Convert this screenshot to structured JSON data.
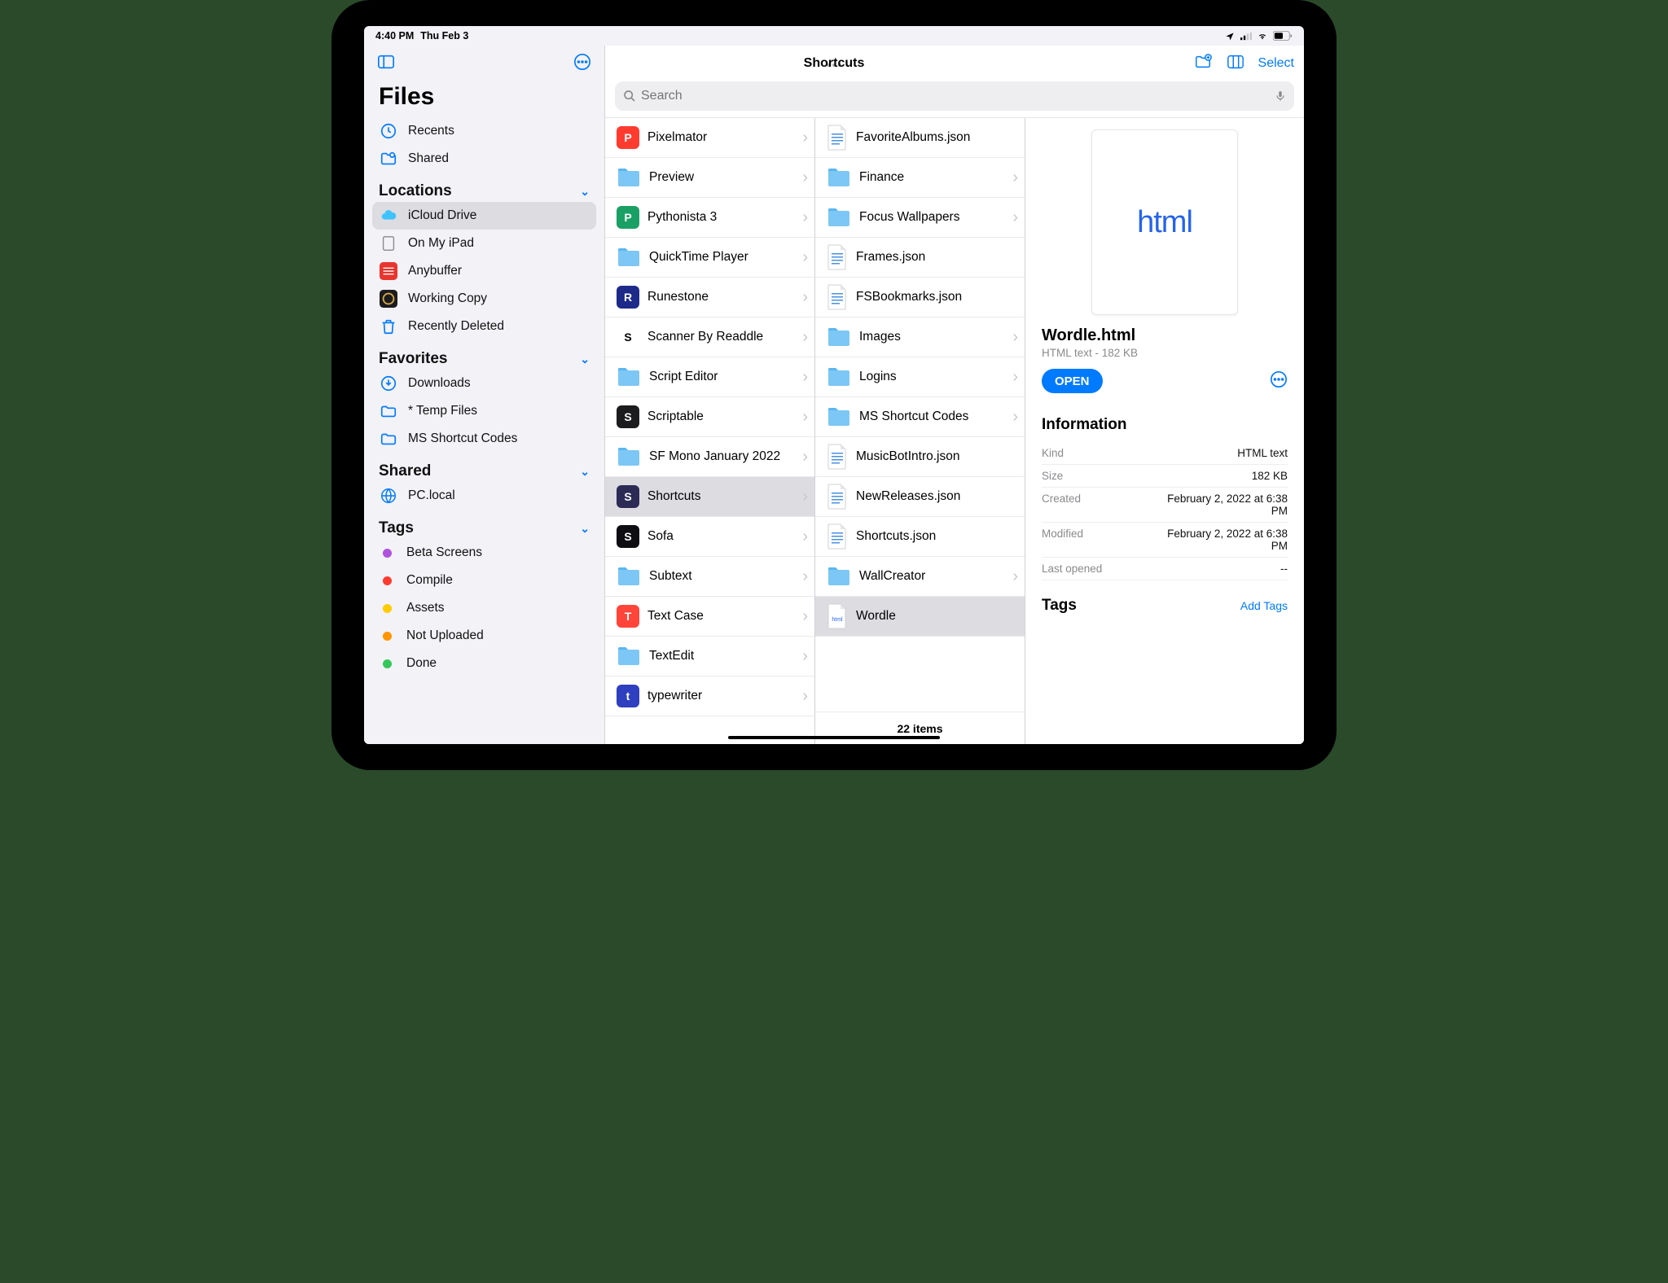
{
  "status": {
    "time": "4:40 PM",
    "date": "Thu Feb 3"
  },
  "sidebar": {
    "title": "Files",
    "recents": "Recents",
    "shared": "Shared",
    "sections": {
      "locations": {
        "header": "Locations",
        "items": [
          {
            "label": "iCloud Drive",
            "selected": true
          },
          {
            "label": "On My iPad"
          },
          {
            "label": "Anybuffer"
          },
          {
            "label": "Working Copy"
          },
          {
            "label": "Recently Deleted"
          }
        ]
      },
      "favorites": {
        "header": "Favorites",
        "items": [
          {
            "label": "Downloads"
          },
          {
            "label": "* Temp Files"
          },
          {
            "label": "MS Shortcut Codes"
          }
        ]
      },
      "shared": {
        "header": "Shared",
        "items": [
          {
            "label": "PC.local"
          }
        ]
      },
      "tags": {
        "header": "Tags",
        "items": [
          {
            "label": "Beta Screens",
            "color": "#af52de"
          },
          {
            "label": "Compile",
            "color": "#ff3b30"
          },
          {
            "label": "Assets",
            "color": "#ffcc00"
          },
          {
            "label": "Not Uploaded",
            "color": "#ff9500"
          },
          {
            "label": "Done",
            "color": "#34c759"
          }
        ]
      }
    }
  },
  "nav": {
    "title": "Shortcuts",
    "select": "Select"
  },
  "search": {
    "placeholder": "Search"
  },
  "col1": [
    {
      "label": "Pixelmator",
      "type": "app",
      "bg": "#ff3b30"
    },
    {
      "label": "Preview",
      "type": "folder"
    },
    {
      "label": "Pythonista 3",
      "type": "app",
      "bg": "#1aa064"
    },
    {
      "label": "QuickTime Player",
      "type": "folder"
    },
    {
      "label": "Runestone",
      "type": "app",
      "bg": "#1d2a8a"
    },
    {
      "label": "Scanner By Readdle",
      "type": "app",
      "bg": "#ffffff",
      "fg": "#000"
    },
    {
      "label": "Script Editor",
      "type": "folder"
    },
    {
      "label": "Scriptable",
      "type": "app",
      "bg": "#1c1c1e"
    },
    {
      "label": "SF Mono January 2022",
      "type": "folder"
    },
    {
      "label": "Shortcuts",
      "type": "app",
      "bg": "#2b2b55",
      "selected": true
    },
    {
      "label": "Sofa",
      "type": "app",
      "bg": "#0d0d12"
    },
    {
      "label": "Subtext",
      "type": "folder"
    },
    {
      "label": "Text Case",
      "type": "app",
      "bg": "#ff453a"
    },
    {
      "label": "TextEdit",
      "type": "folder"
    },
    {
      "label": "typewriter",
      "type": "app",
      "bg": "#2e3fbf"
    }
  ],
  "col2": {
    "items": [
      {
        "label": "FavoriteAlbums.json",
        "type": "file"
      },
      {
        "label": "Finance",
        "type": "folder"
      },
      {
        "label": "Focus Wallpapers",
        "type": "folder"
      },
      {
        "label": "Frames.json",
        "type": "file"
      },
      {
        "label": "FSBookmarks.json",
        "type": "file"
      },
      {
        "label": "Images",
        "type": "folder"
      },
      {
        "label": "Logins",
        "type": "folder"
      },
      {
        "label": "MS Shortcut Codes",
        "type": "folder"
      },
      {
        "label": "MusicBotIntro.json",
        "type": "file"
      },
      {
        "label": "NewReleases.json",
        "type": "file"
      },
      {
        "label": "Shortcuts.json",
        "type": "file"
      },
      {
        "label": "WallCreator",
        "type": "folder"
      },
      {
        "label": "Wordle",
        "type": "html",
        "selected": true
      }
    ],
    "count": "22 items"
  },
  "detail": {
    "preview_label": "html",
    "name": "Wordle.html",
    "sub": "HTML text - 182 KB",
    "open": "OPEN",
    "info_header": "Information",
    "rows": [
      {
        "k": "Kind",
        "v": "HTML text"
      },
      {
        "k": "Size",
        "v": "182 KB"
      },
      {
        "k": "Created",
        "v": "February 2, 2022 at 6:38 PM"
      },
      {
        "k": "Modified",
        "v": "February 2, 2022 at 6:38 PM"
      },
      {
        "k": "Last opened",
        "v": "--"
      }
    ],
    "tags_header": "Tags",
    "add_tags": "Add Tags"
  }
}
